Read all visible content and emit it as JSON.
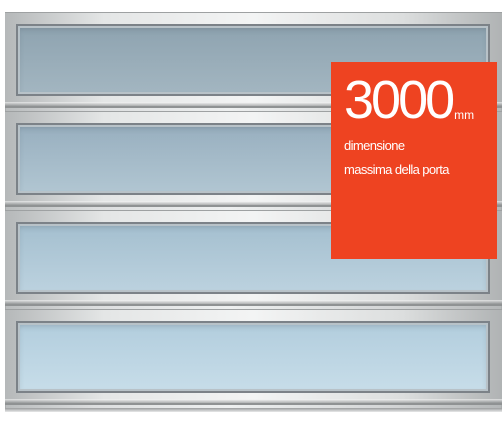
{
  "promo": {
    "size_value": "3000",
    "size_unit": "mm",
    "caption_line1": "dimensione",
    "caption_line2": "massima della porta"
  },
  "colors": {
    "badge_background": "#ee4321",
    "badge_text": "#ffffff",
    "glass_top": "#8ea3b0",
    "glass_bottom": "#c7dde9",
    "frame": "#dcdedf"
  },
  "door": {
    "panel_count": 4,
    "panel_style": "frosted glass with aluminium frame"
  }
}
